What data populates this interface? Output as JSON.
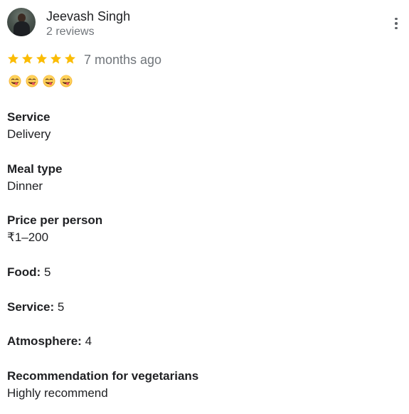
{
  "review": {
    "author_name": "Jeevash Singh",
    "author_reviews": "2 reviews",
    "rating": 5,
    "time_ago": "7 months ago",
    "emoji_icons": [
      "face-savoring-food-icon",
      "face-savoring-food-icon",
      "face-savoring-food-icon",
      "face-savoring-food-icon"
    ],
    "service_label": "Service",
    "service_value": "Delivery",
    "meal_type_label": "Meal type",
    "meal_type_value": "Dinner",
    "price_label": "Price per person",
    "price_value": "₹1–200",
    "food_label": "Food:",
    "food_value": "5",
    "service_rating_label": "Service:",
    "service_rating_value": "5",
    "atmosphere_label": "Atmosphere:",
    "atmosphere_value": "4",
    "recommendation_label": "Recommendation for vegetarians",
    "recommendation_value": "Highly recommend"
  },
  "colors": {
    "star": "#fbbc04",
    "secondary_text": "#70757a",
    "primary_text": "#202124"
  }
}
